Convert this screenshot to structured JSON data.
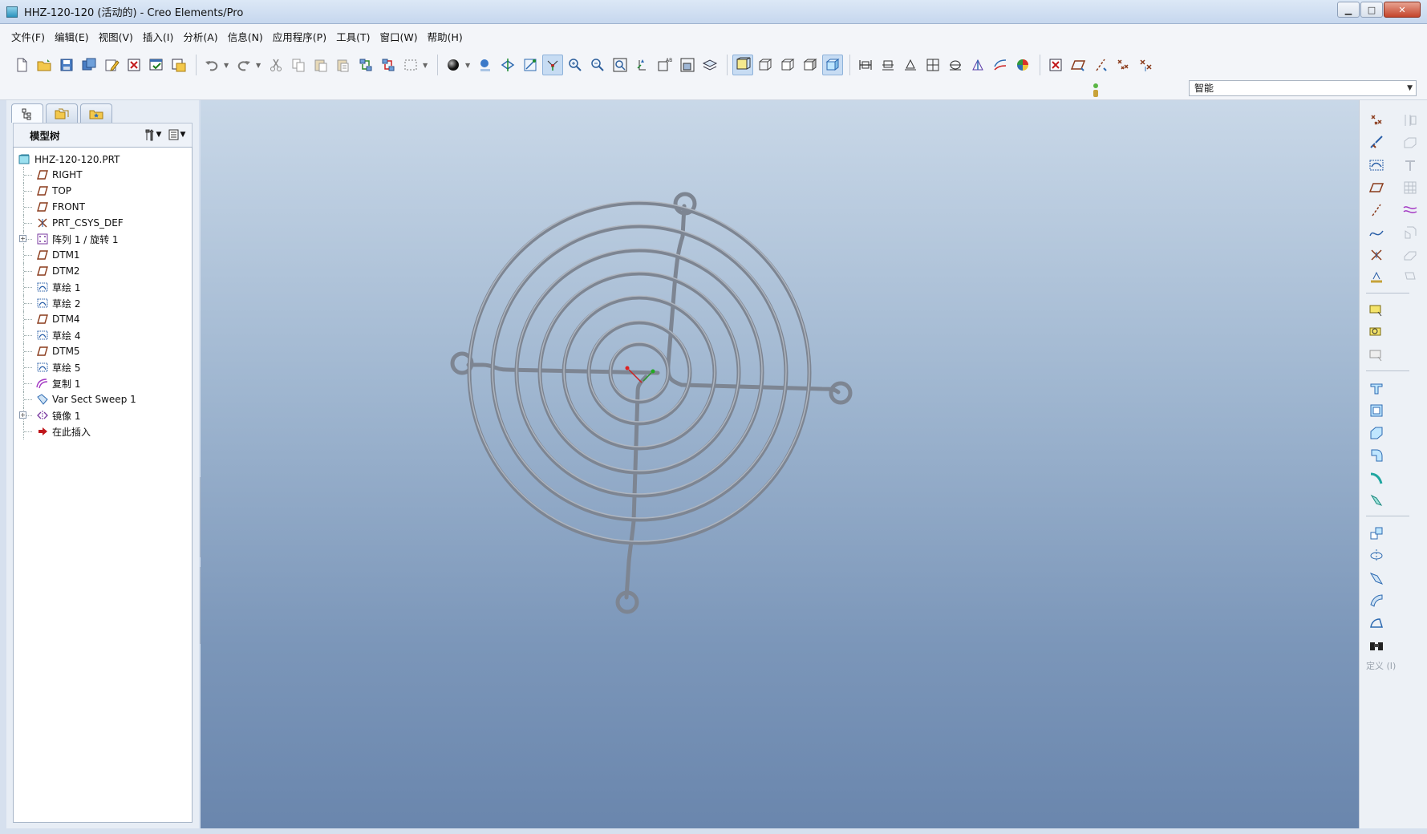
{
  "window": {
    "title": "HHZ-120-120 (活动的) - Creo Elements/Pro",
    "minimize": "▁",
    "maximize": "□",
    "close": "✕"
  },
  "menu": [
    {
      "label": "文件(F)"
    },
    {
      "label": "编辑(E)"
    },
    {
      "label": "视图(V)"
    },
    {
      "label": "插入(I)"
    },
    {
      "label": "分析(A)"
    },
    {
      "label": "信息(N)"
    },
    {
      "label": "应用程序(P)"
    },
    {
      "label": "工具(T)"
    },
    {
      "label": "窗口(W)"
    },
    {
      "label": "帮助(H)"
    }
  ],
  "filter": {
    "value": "智能"
  },
  "model_tree": {
    "header": "模型树",
    "root": "HHZ-120-120.PRT",
    "items": [
      {
        "label": "RIGHT",
        "icon": "datum-plane-icon",
        "expandable": false
      },
      {
        "label": "TOP",
        "icon": "datum-plane-icon",
        "expandable": false
      },
      {
        "label": "FRONT",
        "icon": "datum-plane-icon",
        "expandable": false
      },
      {
        "label": "PRT_CSYS_DEF",
        "icon": "coordinate-system-icon",
        "expandable": false
      },
      {
        "label": "阵列 1 / 旋转 1",
        "icon": "pattern-icon",
        "expandable": true
      },
      {
        "label": "DTM1",
        "icon": "datum-plane-icon",
        "expandable": false
      },
      {
        "label": "DTM2",
        "icon": "datum-plane-icon",
        "expandable": false
      },
      {
        "label": "草绘 1",
        "icon": "sketch-icon",
        "expandable": false
      },
      {
        "label": "草绘 2",
        "icon": "sketch-icon",
        "expandable": false
      },
      {
        "label": "DTM4",
        "icon": "datum-plane-icon",
        "expandable": false
      },
      {
        "label": "草绘 4",
        "icon": "sketch-icon",
        "expandable": false
      },
      {
        "label": "DTM5",
        "icon": "datum-plane-icon",
        "expandable": false
      },
      {
        "label": "草绘 5",
        "icon": "sketch-icon",
        "expandable": false
      },
      {
        "label": "复制 1",
        "icon": "copy-surface-icon",
        "expandable": false
      },
      {
        "label": "Var Sect Sweep 1",
        "icon": "sweep-icon",
        "expandable": false
      },
      {
        "label": "镜像 1",
        "icon": "mirror-icon",
        "expandable": true
      },
      {
        "label": "在此插入",
        "icon": "insert-here-icon",
        "expandable": false
      }
    ]
  },
  "right_toolbar": {
    "define_label": "定义 (I)"
  },
  "colors": {
    "accent": "#2f6fb8",
    "datum_plane": "#8a3a1a",
    "sketch": "#2a5fa8",
    "insert_arrow": "#c0161b"
  }
}
